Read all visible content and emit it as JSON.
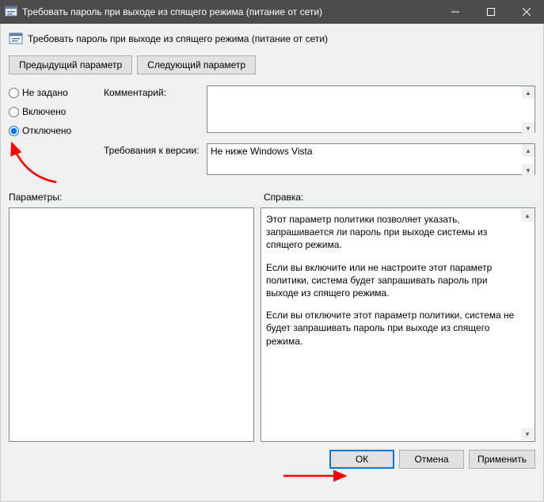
{
  "window": {
    "title": "Требовать пароль при выходе из спящего режима (питание от сети)"
  },
  "header": {
    "subtitle": "Требовать пароль при выходе из спящего режима (питание от сети)"
  },
  "nav": {
    "prev": "Предыдущий параметр",
    "next": "Следующий параметр"
  },
  "radios": {
    "not_configured": "Не задано",
    "enabled": "Включено",
    "disabled": "Отключено",
    "selected": "disabled"
  },
  "fields": {
    "comment_label": "Комментарий:",
    "comment_value": "",
    "supported_label": "Требования к версии:",
    "supported_value": "Не ниже Windows Vista"
  },
  "sections": {
    "options_label": "Параметры:",
    "help_label": "Справка:"
  },
  "help": {
    "p1": "Этот параметр политики позволяет указать, запрашивается ли пароль при выходе системы из спящего режима.",
    "p2": "Если вы включите или не настроите этот параметр политики, система будет запрашивать пароль при выходе из спящего режима.",
    "p3": "Если вы отключите этот параметр политики, система не будет запрашивать пароль при выходе из спящего режима."
  },
  "footer": {
    "ok": "ОК",
    "cancel": "Отмена",
    "apply": "Применить"
  }
}
